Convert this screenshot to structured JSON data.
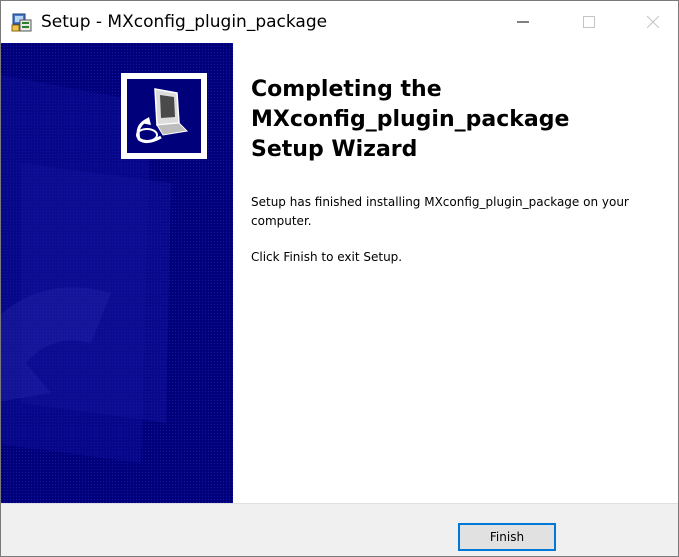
{
  "window": {
    "title": "Setup - MXconfig_plugin_package",
    "controls": [
      "minimize-icon",
      "maximize-icon",
      "close-icon"
    ]
  },
  "wizard": {
    "heading_lines": [
      "Completing the",
      "MXconfig_plugin_package",
      "Setup Wizard"
    ],
    "paragraph1": "Setup has finished installing MXconfig_plugin_package on your computer.",
    "paragraph2": "Click Finish to exit Setup."
  },
  "buttons": {
    "finish_label": "Finish"
  },
  "colors": {
    "banner": "#00007b",
    "focus_border": "#0078d7",
    "button_face": "#e1e1e1",
    "footer": "#f0f0f0"
  }
}
